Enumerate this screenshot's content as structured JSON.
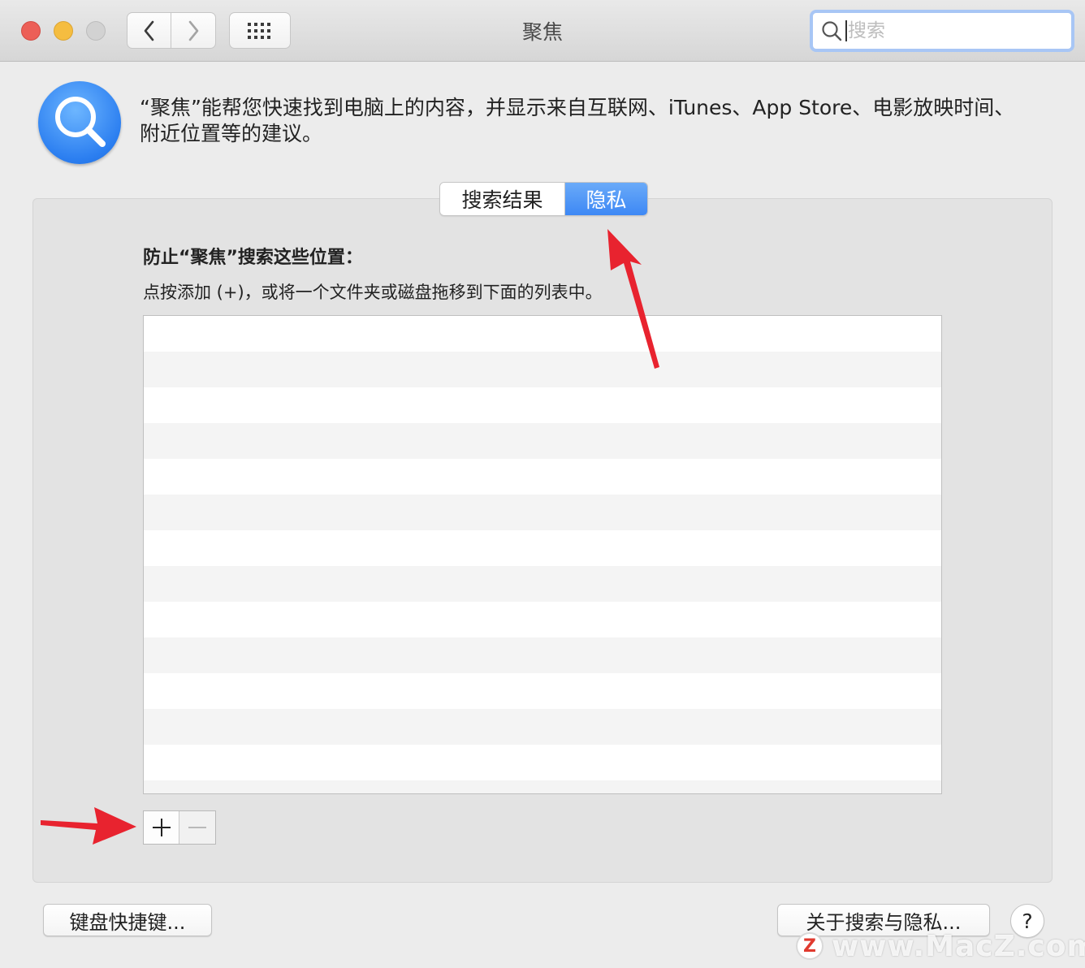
{
  "window": {
    "title": "聚焦"
  },
  "toolbar": {
    "back_icon": "chevron-left-icon",
    "forward_icon": "chevron-right-icon",
    "grid_icon": "grid-icon",
    "search": {
      "placeholder": "搜索",
      "value": ""
    }
  },
  "header": {
    "icon": "spotlight-magnifier-icon",
    "description": "“聚焦”能帮您快速找到电脑上的内容，并显示来自互联网、iTunes、App Store、电影放映时间、附近位置等的建议。"
  },
  "tabs": [
    {
      "label": "搜索结果",
      "selected": false
    },
    {
      "label": "隐私",
      "selected": true
    }
  ],
  "privacy": {
    "title": "防止“聚焦”搜索这些位置：",
    "hint": "点按添加 (+)，或将一个文件夹或磁盘拖移到下面的列表中。",
    "items": []
  },
  "list_controls": {
    "add_icon": "plus-icon",
    "remove_icon": "minus-icon",
    "remove_enabled": false
  },
  "footer": {
    "keyboard_shortcuts": "键盘快捷键...",
    "about_privacy": "关于搜索与隐私...",
    "help": "?"
  },
  "watermark": {
    "logo": "Z",
    "text": "www.MacZ.com"
  },
  "colors": {
    "accent": "#3d88f5",
    "annotation_arrow": "#e8232f"
  }
}
